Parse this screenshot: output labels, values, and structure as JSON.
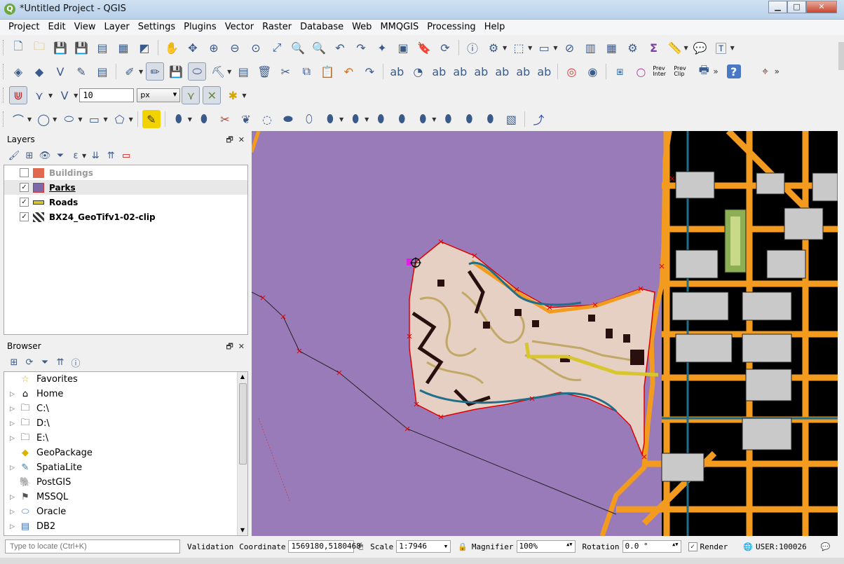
{
  "window": {
    "title": "*Untitled Project - QGIS",
    "app_icon": "qgis-icon",
    "btn_min": "▁",
    "btn_max": "□",
    "btn_close": "✕"
  },
  "menu": [
    "Project",
    "Edit",
    "View",
    "Layer",
    "Settings",
    "Plugins",
    "Vector",
    "Raster",
    "Database",
    "Web",
    "MMQGIS",
    "Processing",
    "Help"
  ],
  "toolbar3": {
    "snap_tolerance": "10",
    "snap_unit": "px"
  },
  "toolbar2": {
    "prev_inter_label": "Prev Inter",
    "prev_clip_label": "Prev Clip"
  },
  "layers_panel": {
    "title": "Layers",
    "layers": [
      {
        "name": "Buildings",
        "checked": false,
        "symbol_color": "#e0694f"
      },
      {
        "name": "Parks",
        "checked": true,
        "symbol_color": "#7e69a8"
      },
      {
        "name": "Roads",
        "checked": true,
        "symbol_color": "#d7c62e"
      },
      {
        "name": "BX24_GeoTifv1-02-clip",
        "checked": true,
        "symbol_color": "#333333"
      }
    ]
  },
  "browser_panel": {
    "title": "Browser",
    "items": [
      {
        "label": "Favorites",
        "icon": "star-icon"
      },
      {
        "label": "Home",
        "icon": "home-icon"
      },
      {
        "label": "C:\\",
        "icon": "folder-icon"
      },
      {
        "label": "D:\\",
        "icon": "folder-icon"
      },
      {
        "label": "E:\\",
        "icon": "folder-icon"
      },
      {
        "label": "GeoPackage",
        "icon": "geopackage-icon"
      },
      {
        "label": "SpatiaLite",
        "icon": "spatialite-icon"
      },
      {
        "label": "PostGIS",
        "icon": "postgis-icon"
      },
      {
        "label": "MSSQL",
        "icon": "mssql-icon"
      },
      {
        "label": "Oracle",
        "icon": "oracle-icon"
      },
      {
        "label": "DB2",
        "icon": "db2-icon"
      }
    ]
  },
  "statusbar": {
    "locate_placeholder": "Type to locate (Ctrl+K)",
    "validation_label": "Validation",
    "coordinate_label": "Coordinate",
    "coordinate_value": "1569180,5180468",
    "scale_label": "Scale",
    "scale_value": "1:7946",
    "magnifier_label": "Magnifier",
    "magnifier_value": "100%",
    "rotation_label": "Rotation",
    "rotation_value": "0.0 °",
    "render_label": "Render",
    "crs_value": "USER:100026"
  },
  "colors": {
    "water": "#9a7bba",
    "roads": "#f39b1f",
    "park_fill": "#e6cfc3",
    "selection": "#e00000"
  }
}
